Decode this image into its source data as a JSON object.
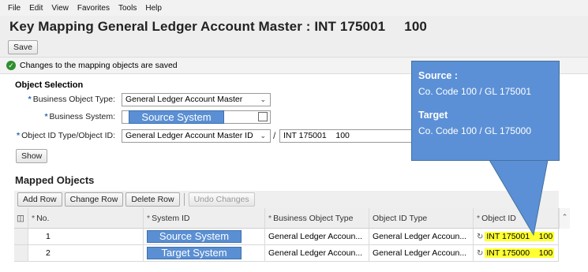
{
  "menu": [
    "File",
    "Edit",
    "View",
    "Favorites",
    "Tools",
    "Help"
  ],
  "title": "Key Mapping General Ledger Account Master : INT 175001     100",
  "toolbar": {
    "save_label": "Save"
  },
  "message": "Changes to the mapping objects are saved",
  "object_selection": {
    "section_title": "Object Selection",
    "business_object_type_label": "Business Object Type:",
    "business_object_type_value": "General Ledger Account Master",
    "business_system_label": "Business System:",
    "business_system_value": "Source System",
    "object_id_type_label": "Object ID Type/Object ID:",
    "object_id_type_value": "General Ledger Account Master ID",
    "object_id_value": "INT 175001    100",
    "slash": "/",
    "show_label": "Show"
  },
  "mapped_objects": {
    "title": "Mapped Objects",
    "buttons": {
      "add_row": "Add Row",
      "change_row": "Change Row",
      "delete_row": "Delete Row",
      "undo_changes": "Undo Changes"
    },
    "columns": [
      "No.",
      "System ID",
      "Business Object Type",
      "Object ID Type",
      "Object ID"
    ],
    "rows": [
      {
        "no": "1",
        "system": "Source System",
        "bo_type": "General Ledger Accoun...",
        "id_type": "General Ledger Accoun...",
        "object_id": "INT 175001    100"
      },
      {
        "no": "2",
        "system": "Target System",
        "bo_type": "General Ledger Accoun...",
        "id_type": "General Ledger Accoun...",
        "object_id": "INT 175000    100"
      }
    ]
  },
  "callout": {
    "source_heading": "Source :",
    "source_text": "Co. Code 100 / GL 175001",
    "target_heading": "Target",
    "target_text": "Co. Code 100 / GL 175000"
  },
  "colors": {
    "callout_bg": "#5b90d6",
    "label_bg": "#5a8fd3",
    "highlight": "#ffff33",
    "success": "#2f8f2f"
  },
  "icons": [
    "success-check-icon",
    "value-help-icon",
    "dropdown-caret-icon",
    "connection-icon",
    "table-settings-icon",
    "scroll-up-icon"
  ]
}
